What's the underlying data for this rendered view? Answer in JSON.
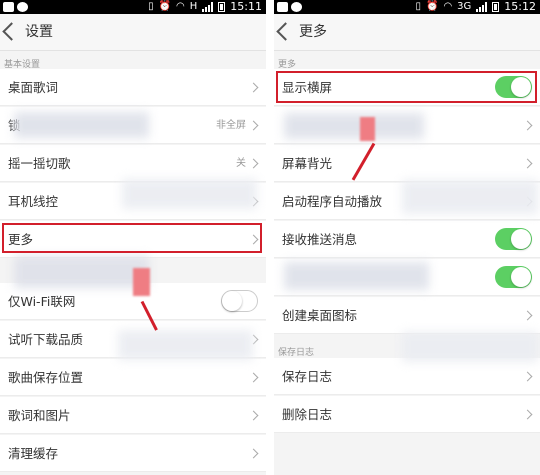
{
  "status_bar": {
    "left_time": "15:11",
    "right_time": "15:12",
    "network": "H",
    "network_sup": "3G"
  },
  "left_panel": {
    "title": "设置",
    "section_basic": "基本设置",
    "items": [
      {
        "label": "桌面歌词"
      },
      {
        "label": "锁",
        "value": "非全屏"
      },
      {
        "label": "摇一摇切歌",
        "value": "关"
      },
      {
        "label": "耳机线控"
      },
      {
        "label": "更多"
      },
      {
        "label": "仅Wi-Fi联网",
        "toggle_on": false
      },
      {
        "label": "试听下载品质"
      },
      {
        "label": "歌曲保存位置"
      },
      {
        "label": "歌词和图片"
      },
      {
        "label": "清理缓存"
      }
    ]
  },
  "right_panel": {
    "title": "更多",
    "section_more": "更多",
    "section_log": "保存日志",
    "items": [
      {
        "label": "显示横屏",
        "toggle_on": true
      },
      {
        "label": ""
      },
      {
        "label": "屏幕背光"
      },
      {
        "label": "启动程序自动播放"
      },
      {
        "label": "接收推送消息",
        "toggle_on": true
      },
      {
        "label": "",
        "toggle_on": true
      },
      {
        "label": "创建桌面图标"
      },
      {
        "label": "保存日志"
      },
      {
        "label": "删除日志"
      }
    ]
  },
  "colors": {
    "highlight": "#d21f2b",
    "toggle_on": "#5ccf63"
  }
}
